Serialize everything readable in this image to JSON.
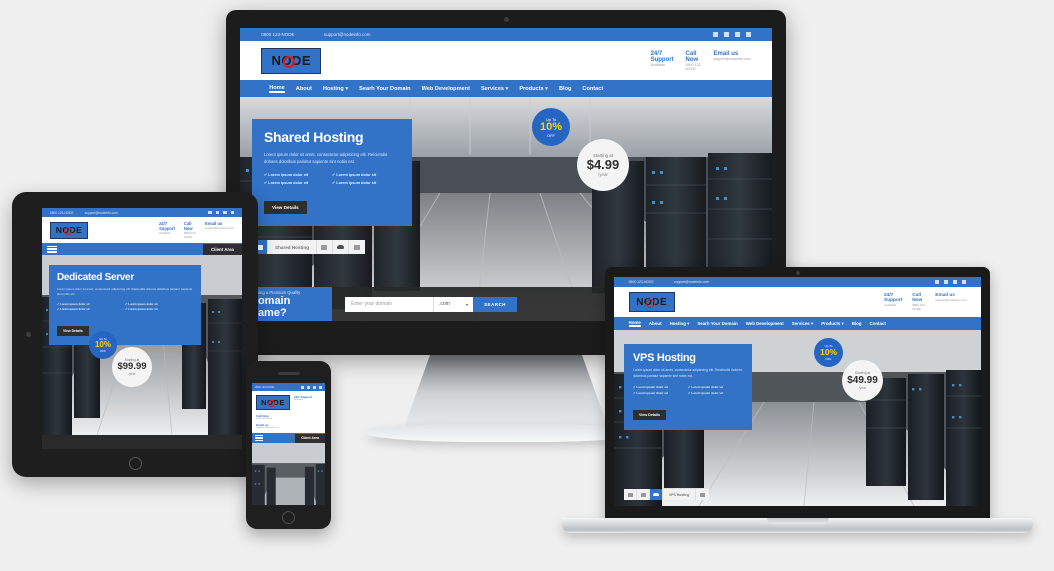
{
  "page": {
    "background": "#efefef",
    "accent": "#3273c8",
    "accent_dark": "#2566c2",
    "dark": "#2f2f2f"
  },
  "site": {
    "topbar": {
      "phone": "0800 123-NODE",
      "email": "support@nodeinfo.com",
      "social": [
        "facebook-icon",
        "twitter-icon",
        "googleplus-icon",
        "linkedin-icon"
      ]
    },
    "logo": {
      "text": "NODE"
    },
    "contacts": [
      {
        "title": "24/7 Support",
        "sub": "Available"
      },
      {
        "title": "Call Now",
        "sub": "0800 123-NODE"
      },
      {
        "title": "Email us",
        "sub": "support@nodeinfo.com"
      }
    ],
    "nav": [
      {
        "label": "Home",
        "caret": "",
        "active": true
      },
      {
        "label": "About",
        "caret": ""
      },
      {
        "label": "Hosting",
        "caret": "▾"
      },
      {
        "label": "Searh Your Domain",
        "caret": ""
      },
      {
        "label": "Web Development",
        "caret": ""
      },
      {
        "label": "Services",
        "caret": "▾"
      },
      {
        "label": "Products",
        "caret": "▾"
      },
      {
        "label": "Blog",
        "caret": ""
      },
      {
        "label": "Contact",
        "caret": ""
      }
    ],
    "mobile_nav": {
      "menu_icon": "hamburger-icon",
      "client_area": "Client Area"
    },
    "hero_body": "Lorem ipsum dolor sit amet, consectetur adipisicing elit. Reiciendis dolores doloribus pariatur sapiente sint nobis est.",
    "features": [
      "Lorem ipsum dolor sit",
      "Lorem ipsum dolor sit",
      "Lorem ipsum dolor sit",
      "Lorem ipsum dolor sit"
    ],
    "cta": "View Details",
    "offer": {
      "top": "Up To",
      "big": "10%",
      "bottom": "OFF"
    },
    "price_label": "Starting at",
    "price_period": "/year",
    "tabs": [
      {
        "icon": "server-icon",
        "label": ""
      },
      {
        "icon": "shared-hosting-icon",
        "label": "Shared Hosting"
      },
      {
        "icon": "briefcase-icon",
        "label": ""
      },
      {
        "icon": "cloud-icon",
        "label": ""
      },
      {
        "icon": "window-icon",
        "label": ""
      }
    ],
    "domain_search": {
      "kicker": "Looking a Premium Quality",
      "headline": "Domain Name?",
      "placeholder": "Enter your domain",
      "tld": ".com",
      "button": "SEARCH"
    }
  },
  "devices": {
    "monitor": {
      "name": "desktop-monitor",
      "heading": "Shared Hosting",
      "price": "$4.99",
      "active_tab": "Shared Hosting"
    },
    "laptop": {
      "name": "laptop",
      "heading": "VPS Hosting",
      "price": "$49.99",
      "active_tab": "VPS Hosting"
    },
    "tablet": {
      "name": "tablet",
      "heading": "Dedicated Server",
      "price": "$99.99",
      "active_tab": ""
    },
    "phone": {
      "name": "smartphone",
      "heading": "",
      "price": "",
      "active_tab": ""
    }
  }
}
